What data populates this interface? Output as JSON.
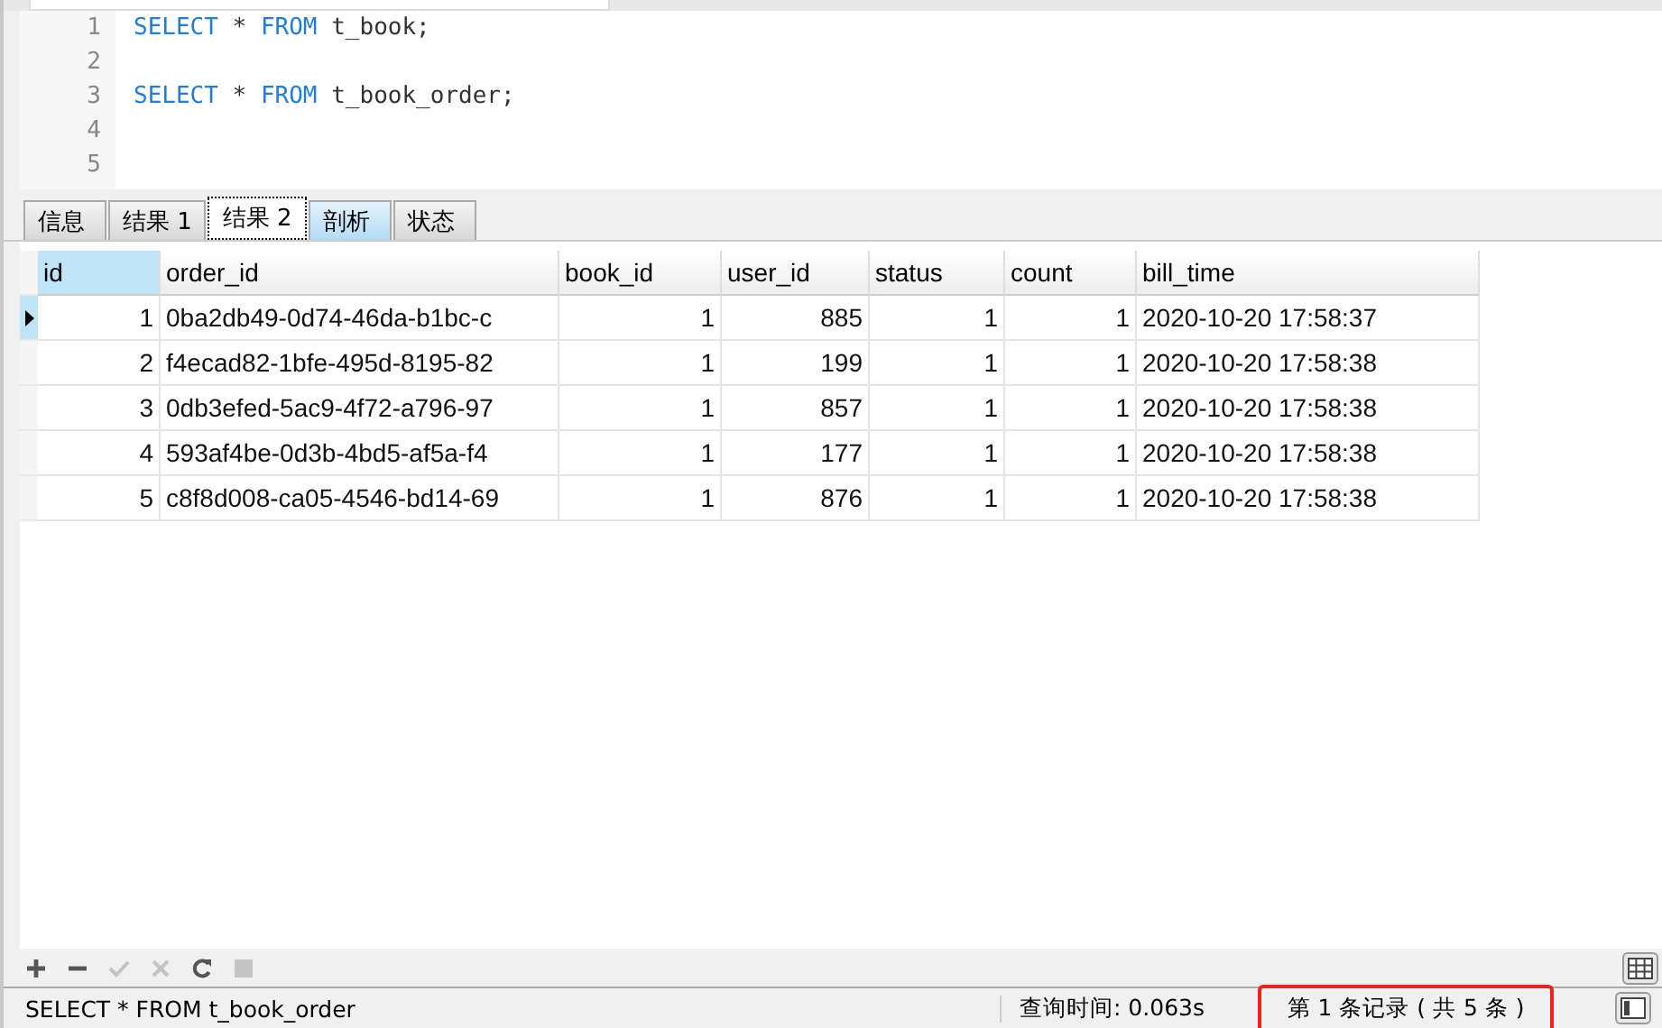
{
  "editor": {
    "lines": [
      {
        "number": "1",
        "tokens": [
          {
            "kind": "keyword",
            "text": "SELECT"
          },
          {
            "kind": "plain",
            "text": " * "
          },
          {
            "kind": "keyword",
            "text": "FROM"
          },
          {
            "kind": "plain",
            "text": " t_book;"
          }
        ]
      },
      {
        "number": "2"
      },
      {
        "number": "3",
        "tokens": [
          {
            "kind": "keyword",
            "text": "SELECT"
          },
          {
            "kind": "plain",
            "text": " * "
          },
          {
            "kind": "keyword",
            "text": "FROM"
          },
          {
            "kind": "plain",
            "text": " t_book_order;"
          }
        ]
      },
      {
        "number": "4"
      },
      {
        "number": "5"
      }
    ]
  },
  "tabs": [
    {
      "label": "信息",
      "selected": false
    },
    {
      "label": "结果 1",
      "selected": false
    },
    {
      "label": "结果 2",
      "selected": true
    },
    {
      "label": "剖析",
      "selected": false
    },
    {
      "label": "状态",
      "selected": false
    }
  ],
  "table": {
    "columns": [
      {
        "label": "id",
        "selected": true
      },
      {
        "label": "order_id",
        "selected": false
      },
      {
        "label": "book_id",
        "selected": false
      },
      {
        "label": "user_id",
        "selected": false
      },
      {
        "label": "status",
        "selected": false
      },
      {
        "label": "count",
        "selected": false
      },
      {
        "label": "bill_time",
        "selected": false
      }
    ],
    "rows": [
      {
        "selected": true,
        "cells": [
          "1",
          "0ba2db49-0d74-46da-b1bc-c",
          "1",
          "885",
          "1",
          "1",
          "2020-10-20 17:58:37"
        ]
      },
      {
        "selected": false,
        "cells": [
          "2",
          "f4ecad82-1bfe-495d-8195-82",
          "1",
          "199",
          "1",
          "1",
          "2020-10-20 17:58:38"
        ]
      },
      {
        "selected": false,
        "cells": [
          "3",
          "0db3efed-5ac9-4f72-a796-97",
          "1",
          "857",
          "1",
          "1",
          "2020-10-20 17:58:38"
        ]
      },
      {
        "selected": false,
        "cells": [
          "4",
          "593af4be-0d3b-4bd5-af5a-f4",
          "1",
          "177",
          "1",
          "1",
          "2020-10-20 17:58:38"
        ]
      },
      {
        "selected": false,
        "cells": [
          "5",
          "c8f8d008-ca05-4546-bd14-69",
          "1",
          "876",
          "1",
          "1",
          "2020-10-20 17:58:38"
        ]
      }
    ]
  },
  "toolbar": [
    {
      "kind": "add",
      "disabled": false
    },
    {
      "kind": "remove",
      "disabled": false
    },
    {
      "kind": "apply",
      "disabled": true
    },
    {
      "kind": "cancel",
      "disabled": true
    },
    {
      "kind": "refresh",
      "disabled": false
    },
    {
      "kind": "stop",
      "disabled": true
    }
  ],
  "status_bar": {
    "sql": "SELECT * FROM t_book_order",
    "query_time": "查询时间: 0.063s",
    "record": "第 1 条记录 ( 共 5 条 )",
    "record_highlighted": true
  }
}
